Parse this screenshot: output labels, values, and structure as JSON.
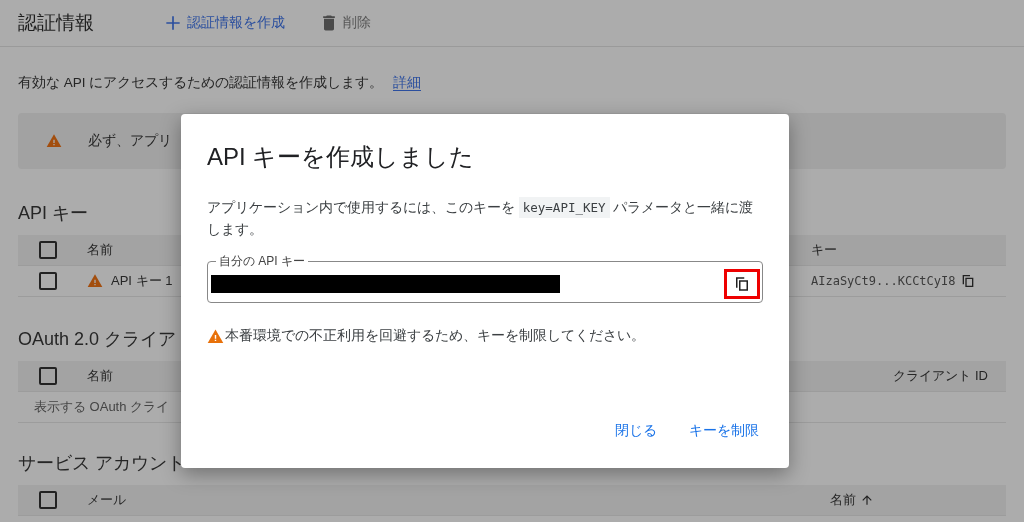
{
  "header": {
    "title": "認証情報",
    "actions": [
      {
        "kind": "create",
        "label": "認証情報を作成"
      },
      {
        "kind": "delete",
        "label": "削除"
      }
    ]
  },
  "description": {
    "text": "有効な API にアクセスするための認証情報を作成します。",
    "link": "詳細"
  },
  "notice": {
    "text": "必ず、アプリ"
  },
  "api_keys": {
    "title": "API キー",
    "header_checked": false,
    "columns": [
      "名前",
      "キー"
    ],
    "rows": [
      {
        "checked": false,
        "warning": true,
        "name": "API キー 1",
        "key": "AIzaSyCt9...KCCtCyI8"
      }
    ]
  },
  "oauth": {
    "title": "OAuth 2.0 クライア",
    "header_checked": false,
    "columns": [
      "名前",
      "クライアント ID"
    ],
    "empty_text": "表示する OAuth クライ"
  },
  "service_accounts": {
    "title": "サービス アカウント",
    "header_checked": false,
    "columns": [
      {
        "label": "メール",
        "sort_ascending": false
      },
      {
        "label": "名前",
        "sort_ascending": true
      }
    ]
  },
  "dialog": {
    "title": "API キーを作成しました",
    "body": [
      {
        "kind": "text",
        "text": "アプリケーション内で使用するには、このキーを "
      },
      {
        "kind": "code",
        "text": "key=API_KEY"
      },
      {
        "kind": "text",
        "text": " パラメータと一緒に渡します。"
      }
    ],
    "key_field": {
      "label": "自分の API キー",
      "redacted": true,
      "copy_highlighted": true
    },
    "warning": "本番環境での不正利用を回避するため、キーを制限してください。",
    "buttons": [
      "閉じる",
      "キーを制限"
    ]
  }
}
